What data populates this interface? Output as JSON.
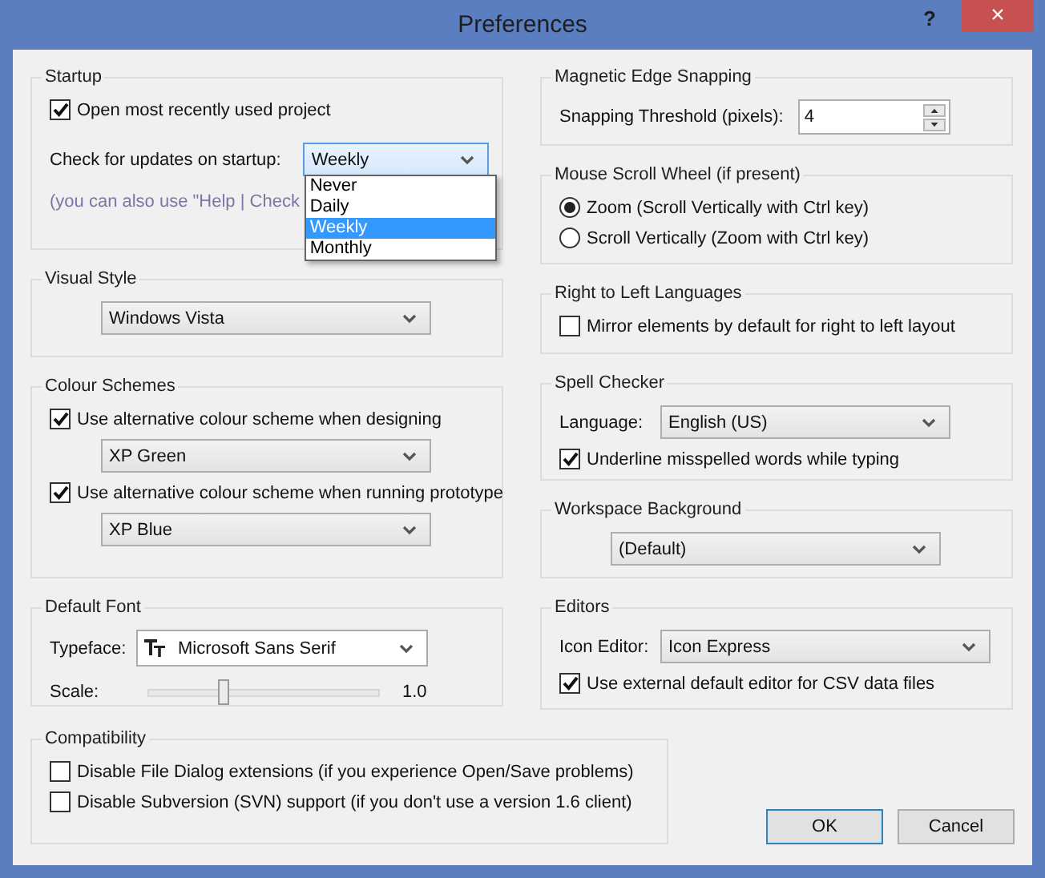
{
  "window": {
    "title": "Preferences",
    "help": "?",
    "close": "×"
  },
  "left_column": [
    {
      "title": "Startup",
      "rows": [
        {
          "kind": "checkbox",
          "label": "Open most recently used project",
          "checked": true
        },
        {
          "kind": "open_select",
          "label": "Check for updates on startup:",
          "value": "Weekly",
          "options": [
            {
              "label": "Never",
              "selected": false
            },
            {
              "label": "Daily",
              "selected": false
            },
            {
              "label": "Weekly",
              "selected": true
            },
            {
              "label": "Monthly",
              "selected": false
            }
          ]
        },
        {
          "kind": "note",
          "text": "(you can also use \"Help | Check"
        }
      ]
    },
    {
      "title": "Visual Style",
      "rows": [
        {
          "kind": "select",
          "value": "Windows Vista"
        }
      ]
    },
    {
      "title": "Colour Schemes",
      "rows": [
        {
          "kind": "checkbox",
          "label": "Use alternative colour scheme when designing",
          "checked": true
        },
        {
          "kind": "select",
          "value": "XP Green"
        },
        {
          "kind": "checkbox",
          "label": "Use alternative colour scheme when running prototype",
          "checked": true
        },
        {
          "kind": "select",
          "value": "XP Blue"
        }
      ]
    },
    {
      "title": "Default Font",
      "rows": [
        {
          "kind": "font_select",
          "label": "Typeface:",
          "value": "Microsoft Sans Serif"
        },
        {
          "kind": "slider",
          "label": "Scale:",
          "level": 0.33,
          "reading": "1.0"
        }
      ]
    }
  ],
  "right_column": [
    {
      "title": "Magnetic Edge Snapping",
      "rows": [
        {
          "kind": "spinner",
          "label": "Snapping Threshold (pixels):",
          "value": "4"
        }
      ]
    },
    {
      "title": "Mouse Scroll Wheel (if present)",
      "rows": [
        {
          "kind": "radio",
          "label": "Zoom (Scroll Vertically with Ctrl key)",
          "selected": true
        },
        {
          "kind": "radio",
          "label": "Scroll Vertically (Zoom with Ctrl key)",
          "selected": false
        }
      ]
    },
    {
      "title": "Right to Left Languages",
      "rows": [
        {
          "kind": "checkbox",
          "label": "Mirror elements by default for right to left layout",
          "checked": false
        }
      ]
    },
    {
      "title": "Spell Checker",
      "rows": [
        {
          "kind": "labeled_select",
          "label": "Language:",
          "value": "English (US)"
        },
        {
          "kind": "checkbox",
          "label": "Underline misspelled words while typing",
          "checked": true
        }
      ]
    },
    {
      "title": "Workspace Background",
      "rows": [
        {
          "kind": "select",
          "value": "(Default)"
        }
      ]
    },
    {
      "title": "Editors",
      "rows": [
        {
          "kind": "labeled_select",
          "label": "Icon Editor:",
          "value": "Icon Express"
        },
        {
          "kind": "checkbox",
          "label": "Use external default editor for CSV data files",
          "checked": true
        }
      ]
    }
  ],
  "compatibility": {
    "title": "Compatibility",
    "rows": [
      {
        "kind": "checkbox",
        "label": "Disable File Dialog extensions (if you experience Open/Save problems)",
        "checked": false
      },
      {
        "kind": "checkbox",
        "label": "Disable Subversion (SVN) support (if you don't use a version 1.6 client)",
        "checked": false
      }
    ]
  },
  "buttons": [
    {
      "label": "OK",
      "focused": true
    },
    {
      "label": "Cancel",
      "focused": false
    }
  ]
}
